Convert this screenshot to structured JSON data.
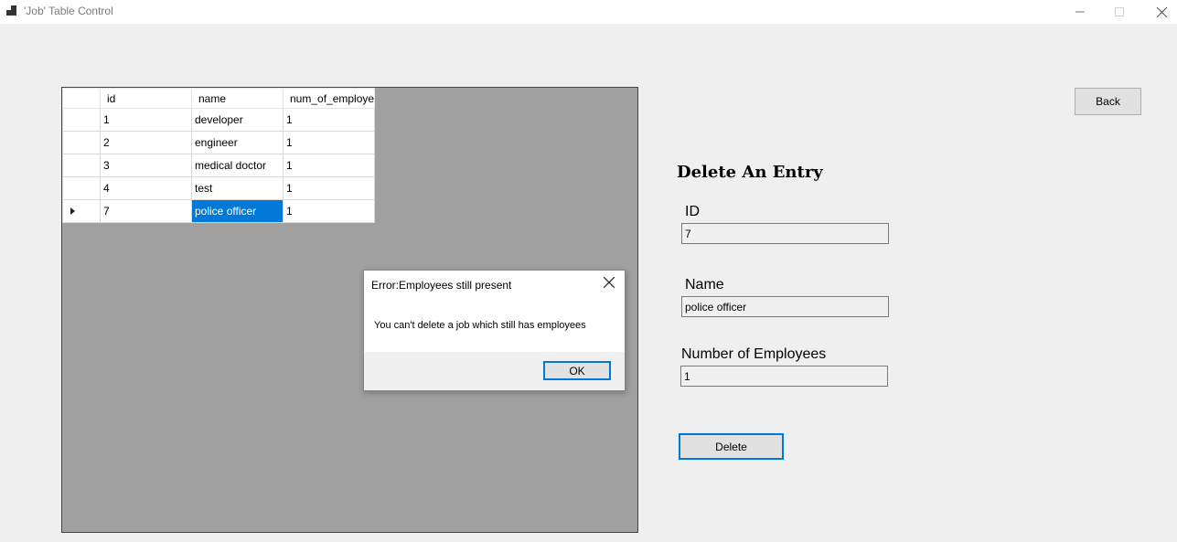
{
  "window": {
    "title": "'Job' Table Control"
  },
  "grid": {
    "columns": [
      "id",
      "name",
      "num_of_employe"
    ],
    "rows": [
      {
        "id": "1",
        "name": "developer",
        "num": "1"
      },
      {
        "id": "2",
        "name": "engineer",
        "num": "1"
      },
      {
        "id": "3",
        "name": "medical doctor",
        "num": "1"
      },
      {
        "id": "4",
        "name": "test",
        "num": "1"
      },
      {
        "id": "7",
        "name": "police officer",
        "num": "1"
      }
    ]
  },
  "panel": {
    "back_label": "Back",
    "heading": "Delete An Entry",
    "id_label": "ID",
    "id_value": "7",
    "name_label": "Name",
    "name_value": "police officer",
    "num_label": "Number of Employees",
    "num_value": "1",
    "delete_label": "Delete"
  },
  "dialog": {
    "title": "Error:Employees still present",
    "message": "You can't delete a job which still has employees",
    "ok_label": "OK"
  },
  "colors": {
    "selection": "#0078d7",
    "grid_background": "#a0a0a0",
    "window_background": "#efefef"
  }
}
